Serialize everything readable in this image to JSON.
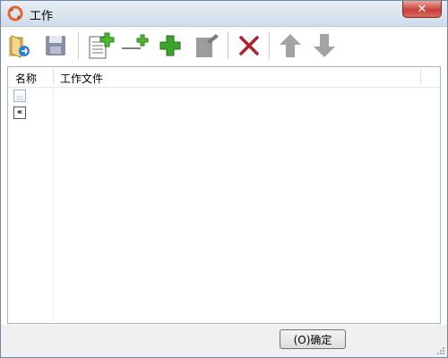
{
  "window": {
    "title": "工作"
  },
  "toolbar": {
    "buttons": [
      {
        "name": "open-folder-icon"
      },
      {
        "name": "save-icon"
      },
      {
        "name": "new-document-icon"
      },
      {
        "name": "add-line-icon"
      },
      {
        "name": "add-icon"
      },
      {
        "name": "edit-icon"
      },
      {
        "name": "delete-icon"
      },
      {
        "name": "move-up-icon"
      },
      {
        "name": "move-down-icon"
      }
    ]
  },
  "list": {
    "columns": [
      "名称",
      "工作文件"
    ],
    "rows": [
      {
        "icon": "file-icon"
      },
      {
        "icon": "back-arrow-icon",
        "text": "«"
      }
    ]
  },
  "footer": {
    "ok_label": "(O)确定"
  },
  "colors": {
    "title_bar": "#cfdcea",
    "close_button": "#c6423a",
    "delete": "#b2202a",
    "add": "#3aa52a"
  }
}
